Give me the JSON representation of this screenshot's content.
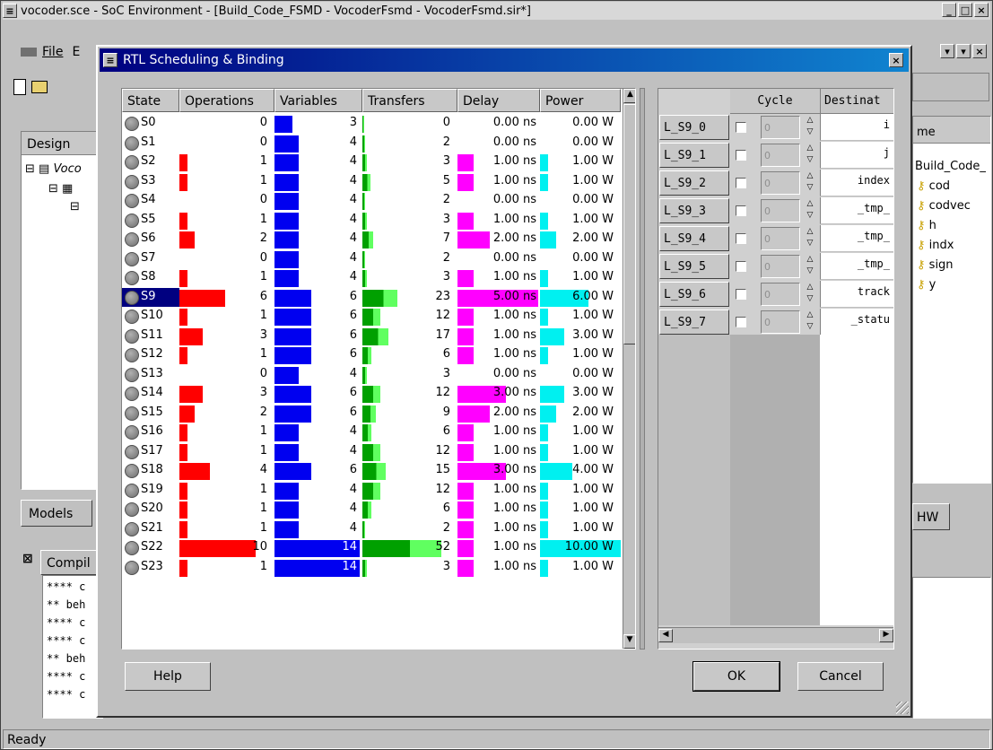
{
  "main_window": {
    "title": "vocoder.sce - SoC Environment - [Build_Code_FSMD - VocoderFsmd - VocoderFsmd.sir*]",
    "menu": [
      "File",
      "E"
    ],
    "design_label": "Design",
    "tree_item": "Voco",
    "models_tab": "Models",
    "compile_tab": "Compil",
    "log_lines": [
      "**** c",
      "** beh",
      "**** c",
      "**** c",
      "** beh",
      "**** c",
      "**** c"
    ],
    "right_header": "me",
    "right_items": [
      "Build_Code_",
      "cod",
      "codvec",
      "h",
      "indx",
      "sign",
      "y"
    ],
    "hw_tab": "HW",
    "status": "Ready"
  },
  "dialog": {
    "title": "RTL Scheduling & Binding",
    "columns": [
      "State",
      "Operations",
      "Variables",
      "Transfers",
      "Delay",
      "Power"
    ],
    "colors": {
      "operations": "#ff0000",
      "variables": "#0000f0",
      "transfers": "#00a000",
      "transfers_light": "#60ff60",
      "delay": "#ff00ff",
      "power": "#00f0f0",
      "selected": "#000080"
    },
    "selected_state": "S9",
    "states": [
      {
        "name": "S0",
        "ops": "0",
        "vars": "3",
        "transfers": "0",
        "delay": "0.00 ns",
        "power": "0.00 W",
        "o": 0,
        "v": 3,
        "t": 0,
        "d": 0,
        "p": 0
      },
      {
        "name": "S1",
        "ops": "0",
        "vars": "4",
        "transfers": "2",
        "delay": "0.00 ns",
        "power": "0.00 W",
        "o": 0,
        "v": 4,
        "t": 2,
        "d": 0,
        "p": 0
      },
      {
        "name": "S2",
        "ops": "1",
        "vars": "4",
        "transfers": "3",
        "delay": "1.00 ns",
        "power": "1.00 W",
        "o": 1,
        "v": 4,
        "t": 3,
        "d": 1,
        "p": 1
      },
      {
        "name": "S3",
        "ops": "1",
        "vars": "4",
        "transfers": "5",
        "delay": "1.00 ns",
        "power": "1.00 W",
        "o": 1,
        "v": 4,
        "t": 5,
        "d": 1,
        "p": 1
      },
      {
        "name": "S4",
        "ops": "0",
        "vars": "4",
        "transfers": "2",
        "delay": "0.00 ns",
        "power": "0.00 W",
        "o": 0,
        "v": 4,
        "t": 2,
        "d": 0,
        "p": 0
      },
      {
        "name": "S5",
        "ops": "1",
        "vars": "4",
        "transfers": "3",
        "delay": "1.00 ns",
        "power": "1.00 W",
        "o": 1,
        "v": 4,
        "t": 3,
        "d": 1,
        "p": 1
      },
      {
        "name": "S6",
        "ops": "2",
        "vars": "4",
        "transfers": "7",
        "delay": "2.00 ns",
        "power": "2.00 W",
        "o": 2,
        "v": 4,
        "t": 7,
        "d": 2,
        "p": 2
      },
      {
        "name": "S7",
        "ops": "0",
        "vars": "4",
        "transfers": "2",
        "delay": "0.00 ns",
        "power": "0.00 W",
        "o": 0,
        "v": 4,
        "t": 2,
        "d": 0,
        "p": 0
      },
      {
        "name": "S8",
        "ops": "1",
        "vars": "4",
        "transfers": "3",
        "delay": "1.00 ns",
        "power": "1.00 W",
        "o": 1,
        "v": 4,
        "t": 3,
        "d": 1,
        "p": 1
      },
      {
        "name": "S9",
        "ops": "6",
        "vars": "6",
        "transfers": "23",
        "delay": "5.00 ns",
        "power": "6.00 W",
        "o": 6,
        "v": 6,
        "t": 23,
        "d": 5,
        "p": 6
      },
      {
        "name": "S10",
        "ops": "1",
        "vars": "6",
        "transfers": "12",
        "delay": "1.00 ns",
        "power": "1.00 W",
        "o": 1,
        "v": 6,
        "t": 12,
        "d": 1,
        "p": 1
      },
      {
        "name": "S11",
        "ops": "3",
        "vars": "6",
        "transfers": "17",
        "delay": "1.00 ns",
        "power": "3.00 W",
        "o": 3,
        "v": 6,
        "t": 17,
        "d": 1,
        "p": 3
      },
      {
        "name": "S12",
        "ops": "1",
        "vars": "6",
        "transfers": "6",
        "delay": "1.00 ns",
        "power": "1.00 W",
        "o": 1,
        "v": 6,
        "t": 6,
        "d": 1,
        "p": 1
      },
      {
        "name": "S13",
        "ops": "0",
        "vars": "4",
        "transfers": "3",
        "delay": "0.00 ns",
        "power": "0.00 W",
        "o": 0,
        "v": 4,
        "t": 3,
        "d": 0,
        "p": 0
      },
      {
        "name": "S14",
        "ops": "3",
        "vars": "6",
        "transfers": "12",
        "delay": "3.00 ns",
        "power": "3.00 W",
        "o": 3,
        "v": 6,
        "t": 12,
        "d": 3,
        "p": 3
      },
      {
        "name": "S15",
        "ops": "2",
        "vars": "6",
        "transfers": "9",
        "delay": "2.00 ns",
        "power": "2.00 W",
        "o": 2,
        "v": 6,
        "t": 9,
        "d": 2,
        "p": 2
      },
      {
        "name": "S16",
        "ops": "1",
        "vars": "4",
        "transfers": "6",
        "delay": "1.00 ns",
        "power": "1.00 W",
        "o": 1,
        "v": 4,
        "t": 6,
        "d": 1,
        "p": 1
      },
      {
        "name": "S17",
        "ops": "1",
        "vars": "4",
        "transfers": "12",
        "delay": "1.00 ns",
        "power": "1.00 W",
        "o": 1,
        "v": 4,
        "t": 12,
        "d": 1,
        "p": 1
      },
      {
        "name": "S18",
        "ops": "4",
        "vars": "6",
        "transfers": "15",
        "delay": "3.00 ns",
        "power": "4.00 W",
        "o": 4,
        "v": 6,
        "t": 15,
        "d": 3,
        "p": 4
      },
      {
        "name": "S19",
        "ops": "1",
        "vars": "4",
        "transfers": "12",
        "delay": "1.00 ns",
        "power": "1.00 W",
        "o": 1,
        "v": 4,
        "t": 12,
        "d": 1,
        "p": 1
      },
      {
        "name": "S20",
        "ops": "1",
        "vars": "4",
        "transfers": "6",
        "delay": "1.00 ns",
        "power": "1.00 W",
        "o": 1,
        "v": 4,
        "t": 6,
        "d": 1,
        "p": 1
      },
      {
        "name": "S21",
        "ops": "1",
        "vars": "4",
        "transfers": "2",
        "delay": "1.00 ns",
        "power": "1.00 W",
        "o": 1,
        "v": 4,
        "t": 2,
        "d": 1,
        "p": 1
      },
      {
        "name": "S22",
        "ops": "10",
        "vars": "14",
        "transfers": "52",
        "delay": "1.00 ns",
        "power": "10.00 W",
        "o": 10,
        "v": 14,
        "t": 52,
        "d": 1,
        "p": 10
      },
      {
        "name": "S23",
        "ops": "1",
        "vars": "14",
        "transfers": "3",
        "delay": "1.00 ns",
        "power": "1.00 W",
        "o": 1,
        "v": 14,
        "t": 3,
        "d": 1,
        "p": 1
      }
    ],
    "schedule": {
      "cycle_header": "Cycle",
      "dest_header": "Destinat",
      "rows": [
        {
          "label": "L_S9_0",
          "cycle": "0",
          "dest": "i"
        },
        {
          "label": "L_S9_1",
          "cycle": "0",
          "dest": "j"
        },
        {
          "label": "L_S9_2",
          "cycle": "0",
          "dest": "index"
        },
        {
          "label": "L_S9_3",
          "cycle": "0",
          "dest": "_tmp_"
        },
        {
          "label": "L_S9_4",
          "cycle": "0",
          "dest": "_tmp_"
        },
        {
          "label": "L_S9_5",
          "cycle": "0",
          "dest": "_tmp_"
        },
        {
          "label": "L_S9_6",
          "cycle": "0",
          "dest": "track"
        },
        {
          "label": "L_S9_7",
          "cycle": "0",
          "dest": "_statu"
        }
      ]
    },
    "buttons": {
      "help": "Help",
      "ok": "OK",
      "cancel": "Cancel"
    }
  }
}
